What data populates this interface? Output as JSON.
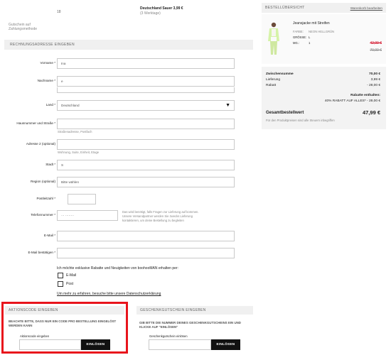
{
  "top": {
    "left_fragment": "18",
    "delivery_line1": "Deutschland Sauer 3,99 €",
    "delivery_line2": "(3 Werktage)",
    "billing_note1": "Gutschein auf",
    "billing_note2": "Zahlungsmethode"
  },
  "billing": {
    "header": "RECHNUNGSADRESSE EINGEBEN",
    "fields": {
      "vorname_label": "Vorname *",
      "vorname_value": "Ina",
      "nachname_label": "Nachname *",
      "nachname_value": "e",
      "land_label": "Land *",
      "land_value": "Deutschland",
      "street_label": "Hausnummer und Straße *",
      "street_value": "",
      "street_hint": "Straßenadresse, Postfach",
      "addr2_label": "Adresse 2 (optional)",
      "addr2_hint": "Wohnung, Suite, Einheit, Etage",
      "city_label": "Stadt *",
      "city_value": "S",
      "region_label": "Region (optional)",
      "region_value": "Bitte wählen",
      "zip_label": "Postleitzahl *",
      "zip_value": "",
      "phone_label": "Telefonnummer *",
      "phone_value": "··· ········",
      "phone_hint": "Das wird benötigt, falls Fragen zur Lieferung auf kommen. Unsere Versandpartner werden Sie zwecks Lieferung kontaktieren, um deine Bestellung zu begleiten",
      "email_label": "E-Mail *",
      "email_value": "",
      "email2_label": "E-Mail bestätigen *",
      "email2_value": ""
    },
    "newsletter_text": "Ich möchte exklusive Rabatte und Neuigkeiten von boohooMAN erhalten per:",
    "opt_email": "E-Mail",
    "opt_post": "Post",
    "privacy_text": "Um mehr zu erfahren, besuche bitte unsere Datenschutzerklärung"
  },
  "promo": {
    "header": "AKTIONSCODE EINGEBEN",
    "note": "BEACHTE BITTE, DASS NUR EIN CODE PRO BESTELLUNG EINGELÖST WERDEN KANN",
    "label": "Aktionscode eingeben",
    "button": "EINLÖSEN",
    "value": ""
  },
  "giftcard": {
    "header": "GESCHENKGUTSCHEIN EINGEBEN",
    "note": "GIB BITTE DIE NUMMER DEINES GESCHENKGUTSCHEINS EIN UND KLICKE AUF \"EINLÖSEN\"",
    "label": "Geschenkgutschein einlösen",
    "button": "EINLÖSEN",
    "value": ""
  },
  "summary": {
    "header": "BESTELLÜBERSICHT",
    "edit_link": "Warenkorb bearbeiten",
    "product": {
      "name": "Jeansjacke mit Streifen",
      "color_label": "FARBE:",
      "color_value": "NEON HELLGRÜN",
      "size_label": "GRÖSSE:",
      "size_value": "L",
      "qty_label": "MG.:",
      "qty_value": "1",
      "price_sale": "42,00 €",
      "price_orig": "70,00 €"
    },
    "subtotal_label": "Zwischensumme",
    "subtotal_value": "70,00 €",
    "shipping_label": "Lieferung",
    "shipping_value": "3,99 €",
    "discount_label": "Rabatt",
    "discount_value": "- 28,00 €",
    "discounts_applied": "Rabatte enthalten:",
    "promo_line": "40% RABATT AUF ALLES* - 28,00 €",
    "total_label": "Gesamtbestellwert",
    "total_value": "47,99 €",
    "tax_note": "Für den Produktpreisen sind alle Steuern inbegriffen"
  },
  "colors": {
    "highlight": "#e8141c",
    "sale": "#d0021b",
    "panel": "#f0f0f0",
    "button": "#111111"
  }
}
